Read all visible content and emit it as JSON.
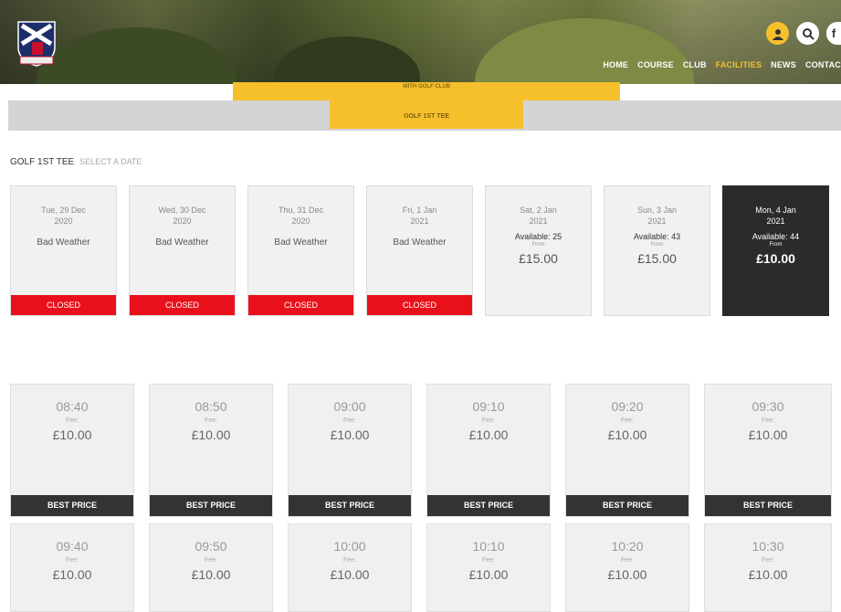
{
  "nav": {
    "items": [
      "HOME",
      "COURSE",
      "CLUB",
      "FACILITIES",
      "NEWS",
      "CONTAC"
    ],
    "active_index": 3
  },
  "submenu": {
    "top_label": "WITH GOLF CLUB",
    "active_tab": "GOLF 1ST TEE"
  },
  "section": {
    "title": "GOLF 1ST TEE",
    "subtitle": "SELECT A DATE"
  },
  "days": [
    {
      "date": "Tue, 29 Dec",
      "year": "2020",
      "status": "Bad Weather",
      "badge": "CLOSED"
    },
    {
      "date": "Wed, 30 Dec",
      "year": "2020",
      "status": "Bad Weather",
      "badge": "CLOSED"
    },
    {
      "date": "Thu, 31 Dec",
      "year": "2020",
      "status": "Bad Weather",
      "badge": "CLOSED"
    },
    {
      "date": "Fri, 1 Jan",
      "year": "2021",
      "status": "Bad Weather",
      "badge": "CLOSED"
    },
    {
      "date": "Sat, 2 Jan",
      "year": "2021",
      "available": "Available: 25",
      "from": "From",
      "price": "£15.00"
    },
    {
      "date": "Sun, 3 Jan",
      "year": "2021",
      "available": "Available: 43",
      "from": "From",
      "price": "£15.00"
    },
    {
      "date": "Mon, 4 Jan",
      "year": "2021",
      "available": "Available: 44",
      "from": "From",
      "price": "£10.00"
    }
  ],
  "slots_row1": [
    {
      "time": "08:40",
      "fee_label": "Fee:",
      "price": "£10.00",
      "badge": "BEST PRICE"
    },
    {
      "time": "08:50",
      "fee_label": "Fee:",
      "price": "£10.00",
      "badge": "BEST PRICE"
    },
    {
      "time": "09:00",
      "fee_label": "Fee:",
      "price": "£10.00",
      "badge": "BEST PRICE"
    },
    {
      "time": "09:10",
      "fee_label": "Fee:",
      "price": "£10.00",
      "badge": "BEST PRICE"
    },
    {
      "time": "09:20",
      "fee_label": "Fee:",
      "price": "£10.00",
      "badge": "BEST PRICE"
    },
    {
      "time": "09:30",
      "fee_label": "Fee:",
      "price": "£10.00",
      "badge": "BEST PRICE"
    }
  ],
  "slots_row2": [
    {
      "time": "09:40",
      "fee_label": "Fee:",
      "price": "£10.00"
    },
    {
      "time": "09:50",
      "fee_label": "Fee:",
      "price": "£10.00"
    },
    {
      "time": "10:00",
      "fee_label": "Fee:",
      "price": "£10.00"
    },
    {
      "time": "10:10",
      "fee_label": "Fee:",
      "price": "£10.00"
    },
    {
      "time": "10:20",
      "fee_label": "Fee:",
      "price": "£10.00"
    },
    {
      "time": "10:30",
      "fee_label": "Fee:",
      "price": "£10.00"
    }
  ],
  "icons": {
    "account": "user-icon",
    "search": "search-icon",
    "social": "facebook-icon"
  },
  "colors": {
    "accent": "#f6c02d",
    "closed": "#e8111b",
    "dark": "#2b2b2b"
  }
}
